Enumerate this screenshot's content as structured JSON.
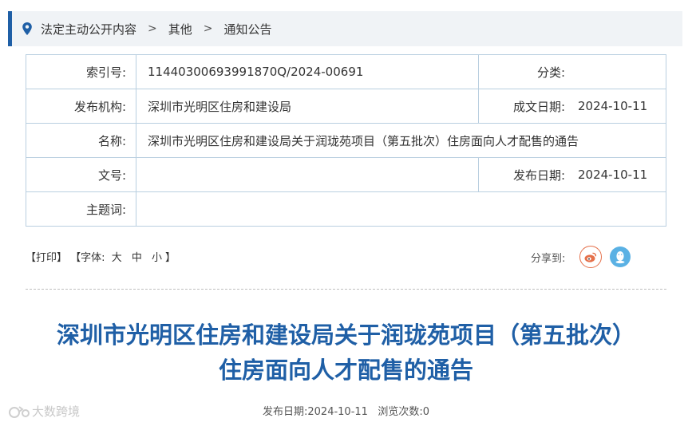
{
  "breadcrumb": {
    "items": [
      "法定主动公开内容",
      "其他",
      "通知公告"
    ],
    "separator": ">"
  },
  "meta": {
    "index_label": "索引号:",
    "index_value": "11440300693991870Q/2024-00691",
    "category_label": "分类:",
    "category_value": "",
    "publisher_label": "发布机构:",
    "publisher_value": "深圳市光明区住房和建设局",
    "date_written_label": "成文日期:",
    "date_written_value": "2024-10-11",
    "name_label": "名称:",
    "name_value": "深圳市光明区住房和建设局关于润珑苑项目（第五批次）住房面向人才配售的通告",
    "doc_no_label": "文号:",
    "doc_no_value": "",
    "publish_date_label": "发布日期:",
    "publish_date_value": "2024-10-11",
    "subject_label": "主题词:",
    "subject_value": ""
  },
  "tools": {
    "print": "【打印】",
    "font_open": "【字体:",
    "large": "大",
    "medium": "中",
    "small": "小",
    "font_close": "】",
    "share_label": "分享到:"
  },
  "article": {
    "title_line1": "深圳市光明区住房和建设局关于润珑苑项目（第五批次）",
    "title_line2": "住房面向人才配售的通告",
    "publish_label": "发布日期:",
    "publish_date": "2024-10-11",
    "views_label": "浏览次数:",
    "views": "0"
  },
  "watermark": "大数跨境",
  "colors": {
    "accent": "#1f5fa6",
    "border": "#b9cfe0",
    "weibo": "#e5704a",
    "qq": "#5ab1e4"
  }
}
